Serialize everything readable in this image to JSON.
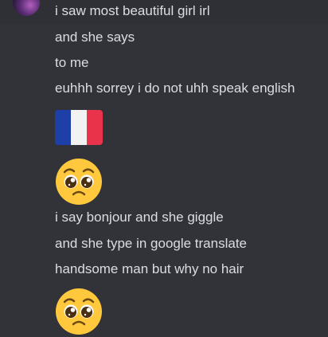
{
  "messages": [
    "i saw most beautiful girl irl",
    "and she says",
    "to me",
    "euhhh sorrey i do not uhh speak english",
    "i say bonjour and she giggle",
    "and she type in google translate",
    "handsome man but why no hair"
  ],
  "emojis": {
    "flag": "flag-france-icon",
    "pleading_1": "pleading-face-icon",
    "pleading_2": "pleading-face-icon"
  },
  "colors": {
    "background": "#313338",
    "hover_row": "#2e3035",
    "text": "#dbdee1",
    "flag_blue": "#1f3fa8",
    "flag_white": "#f2f2f2",
    "flag_red": "#e8334a",
    "emoji_yellow": "#ffc83d"
  }
}
